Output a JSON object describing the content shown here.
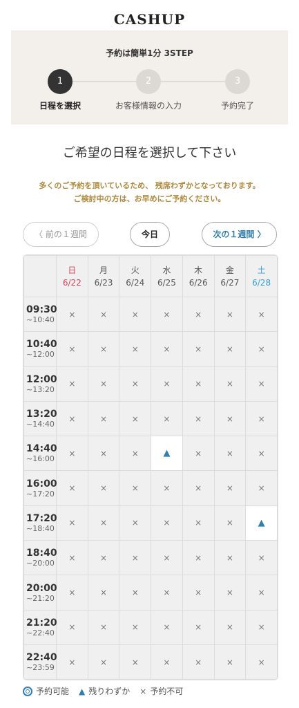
{
  "logo": "CASHUP",
  "steps": {
    "title": "予約は簡単1分 3STEP",
    "items": [
      {
        "num": "1",
        "label": "日程を選択"
      },
      {
        "num": "2",
        "label": "お客様情報の入力"
      },
      {
        "num": "3",
        "label": "予約完了"
      }
    ]
  },
  "heading": "ご希望の日程を選択して下さい",
  "notice": {
    "line1": "多くのご予約を頂いているため、 残席わずかとなっております。",
    "line2": "ご検討中の方は、お早めにご予約ください。"
  },
  "nav": {
    "prev": "〈  前の１週間",
    "today": "今日",
    "next": "次の１週間  〉"
  },
  "days": [
    {
      "dow": "日",
      "date": "6/22"
    },
    {
      "dow": "月",
      "date": "6/23"
    },
    {
      "dow": "火",
      "date": "6/24"
    },
    {
      "dow": "水",
      "date": "6/25"
    },
    {
      "dow": "木",
      "date": "6/26"
    },
    {
      "dow": "金",
      "date": "6/27"
    },
    {
      "dow": "土",
      "date": "6/28"
    }
  ],
  "slots": [
    {
      "start": "09:30",
      "end": "~10:40",
      "cells": [
        "×",
        "×",
        "×",
        "×",
        "×",
        "×",
        "×"
      ]
    },
    {
      "start": "10:40",
      "end": "~12:00",
      "cells": [
        "×",
        "×",
        "×",
        "×",
        "×",
        "×",
        "×"
      ]
    },
    {
      "start": "12:00",
      "end": "~13:20",
      "cells": [
        "×",
        "×",
        "×",
        "×",
        "×",
        "×",
        "×"
      ]
    },
    {
      "start": "13:20",
      "end": "~14:40",
      "cells": [
        "×",
        "×",
        "×",
        "×",
        "×",
        "×",
        "×"
      ]
    },
    {
      "start": "14:40",
      "end": "~16:00",
      "cells": [
        "×",
        "×",
        "×",
        "▲",
        "×",
        "×",
        "×"
      ]
    },
    {
      "start": "16:00",
      "end": "~17:20",
      "cells": [
        "×",
        "×",
        "×",
        "×",
        "×",
        "×",
        "×"
      ]
    },
    {
      "start": "17:20",
      "end": "~18:40",
      "cells": [
        "×",
        "×",
        "×",
        "×",
        "×",
        "×",
        "▲"
      ]
    },
    {
      "start": "18:40",
      "end": "~20:00",
      "cells": [
        "×",
        "×",
        "×",
        "×",
        "×",
        "×",
        "×"
      ]
    },
    {
      "start": "20:00",
      "end": "~21:20",
      "cells": [
        "×",
        "×",
        "×",
        "×",
        "×",
        "×",
        "×"
      ]
    },
    {
      "start": "21:20",
      "end": "~22:40",
      "cells": [
        "×",
        "×",
        "×",
        "×",
        "×",
        "×",
        "×"
      ]
    },
    {
      "start": "22:40",
      "end": "~23:59",
      "cells": [
        "×",
        "×",
        "×",
        "×",
        "×",
        "×",
        "×"
      ]
    }
  ],
  "legend": {
    "available": "予約可能",
    "few": "残りわずか",
    "full": "予約不可"
  },
  "colors": {
    "accent_blue": "#2f7fb3",
    "sunday": "#d2455b",
    "saturday": "#3a9fd6",
    "notice": "#b0893a"
  }
}
